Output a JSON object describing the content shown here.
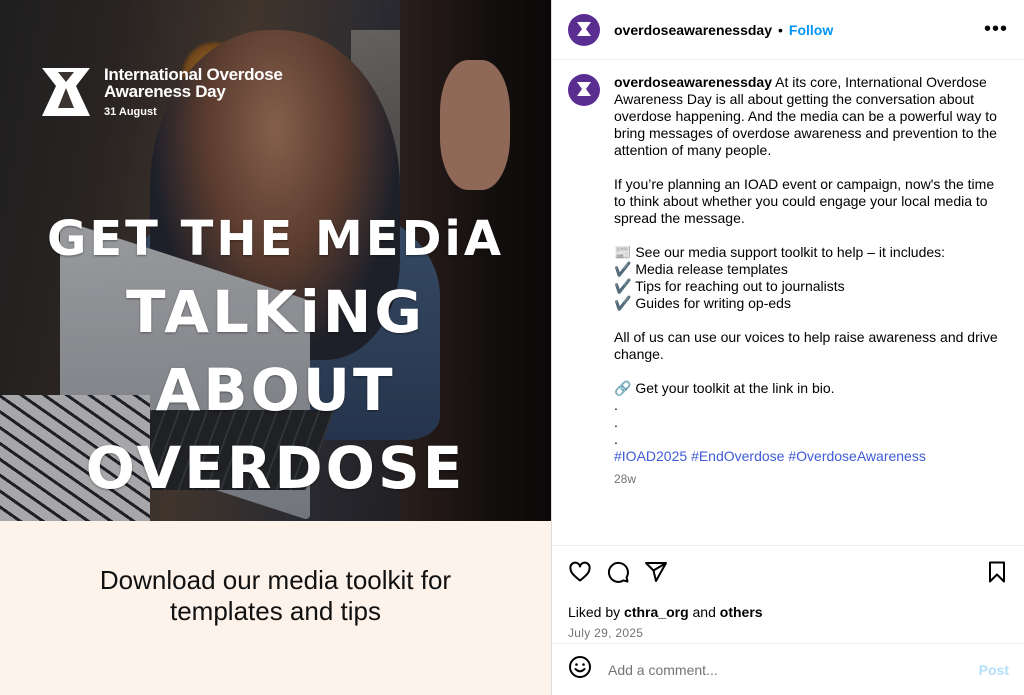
{
  "post_image": {
    "org_name_line1": "International Overdose",
    "org_name_line2": "Awareness Day",
    "org_date": "31 August",
    "headline_line1": "GET THE MEDiA",
    "headline_line2": "TALKiNG ABOUT",
    "headline_line3": "OVERDOSE",
    "banner_line1": "Download our media toolkit for",
    "banner_line2": "templates and tips"
  },
  "header": {
    "username": "overdoseawarenessday",
    "separator": "•",
    "follow_label": "Follow",
    "more_label": "•••"
  },
  "caption": {
    "username": "overdoseawarenessday",
    "paragraph1": "At its core, International Overdose Awareness Day is all about getting the conversation about overdose happening. And the media can be a powerful way to bring messages of overdose awareness and prevention to the attention of many people.",
    "paragraph2": "If you’re planning an IOAD event or campaign, now's the time to think about whether you could engage your local media to spread the message.",
    "toolkit_intro": "📰 See our media support toolkit to help – it includes:",
    "toolkit_items": [
      "✔️ Media release templates",
      "✔️ Tips for reaching out to journalists",
      "✔️ Guides for writing op-eds"
    ],
    "paragraph3": "All of us can use our voices to help raise awareness and drive change.",
    "link_line": "🔗 Get your toolkit at the link in bio.",
    "dots": [
      ".",
      ".",
      "."
    ],
    "hashtags": [
      "#IOAD2025",
      "#EndOverdose",
      "#OverdoseAwareness"
    ],
    "time_ago": "28w"
  },
  "actions": {
    "icons": [
      "heart-icon",
      "comment-icon",
      "share-icon",
      "bookmark-icon"
    ],
    "liked_by_prefix": "Liked by",
    "liked_by_user": "cthra_org",
    "liked_by_and": "and",
    "liked_by_others": "others",
    "date": "July 29, 2025"
  },
  "comment_box": {
    "placeholder": "Add a comment...",
    "post_label": "Post"
  },
  "colors": {
    "follow": "#0095f6",
    "hashtag": "#3f5bd8",
    "avatar": "#5a2d91",
    "banner_bg": "#fdf3ea",
    "post_disabled": "#b2dffc"
  }
}
